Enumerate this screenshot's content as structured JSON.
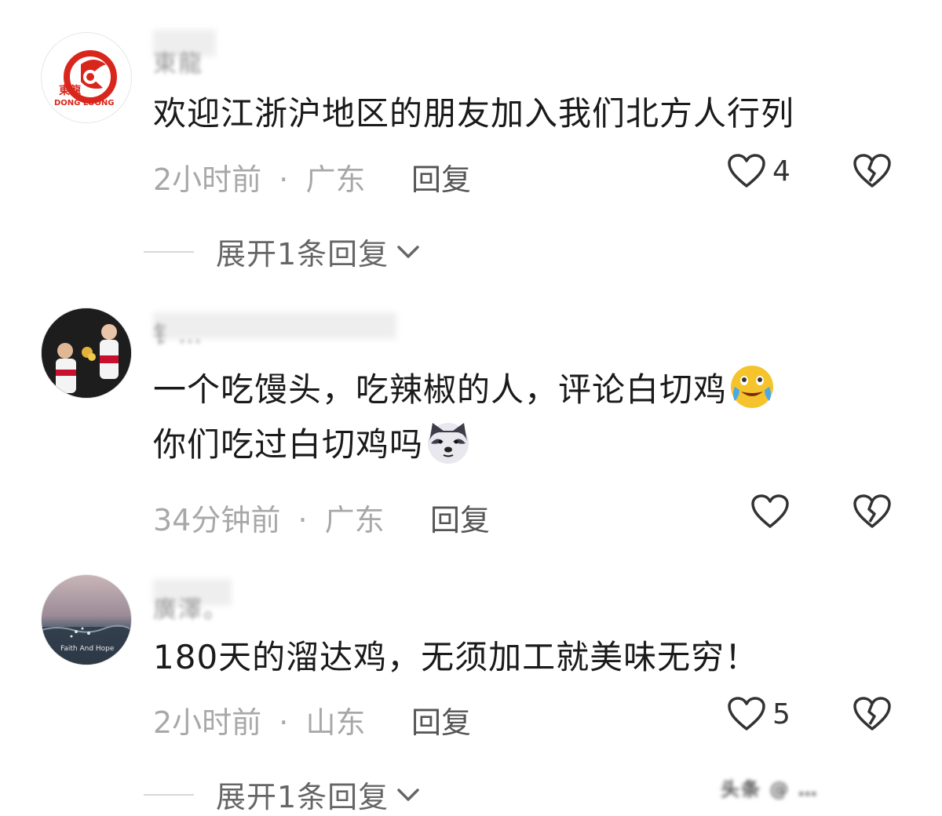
{
  "comments": [
    {
      "username": "東龍",
      "avatar_text": "東龍",
      "avatar_sub": "DONG LOONG",
      "text": "欢迎江浙沪地区的朋友加入我们北方人行列",
      "time": "2小时前",
      "sep": "·",
      "location": "广东",
      "reply_label": "回复",
      "likes": "4",
      "expand_label": "展开1条回复"
    },
    {
      "username": "钅…",
      "text_part1": "一个吃馒头，吃辣椒的人，评论白切鸡",
      "text_part2": "你们吃过白切鸡吗",
      "time": "34分钟前",
      "sep": "·",
      "location": "广东",
      "reply_label": "回复",
      "likes": ""
    },
    {
      "username": "廣澤。",
      "avatar_text": "Faith And Hope",
      "text": "180天的溜达鸡，无须加工就美味无穷！",
      "time": "2小时前",
      "sep": "·",
      "location": "山东",
      "reply_label": "回复",
      "likes": "5",
      "expand_label": "展开1条回复"
    }
  ],
  "watermark": "头条 @ …",
  "colors": {
    "text": "#1a1a1a",
    "meta": "#a8a8a8",
    "avatar_red": "#d9261c"
  }
}
